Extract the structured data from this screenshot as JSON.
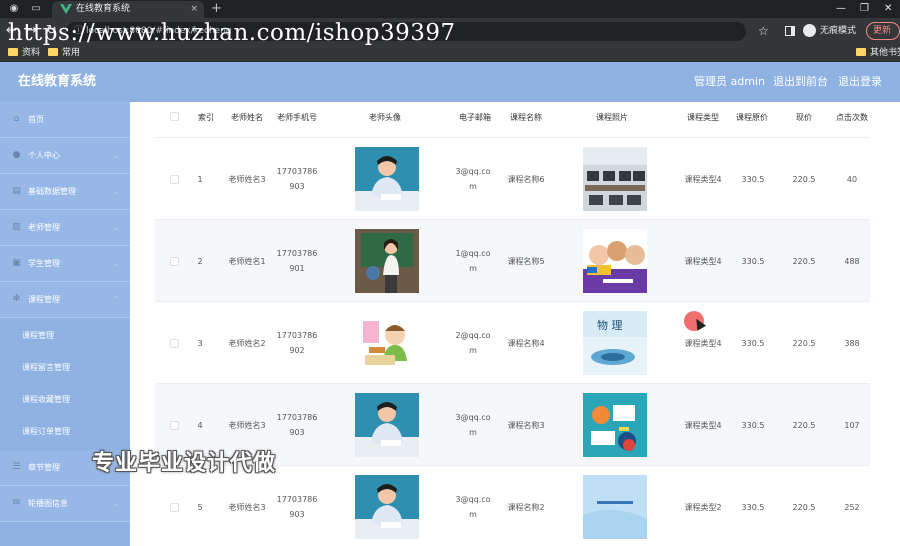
{
  "browser": {
    "tab_title": "在线教育系统",
    "tab_close": "×",
    "new_tab": "+",
    "url_text": "localhost:8080/#/index/kecheng",
    "url_watermark": "https://www.huzhan.com/ishop39397",
    "incognito_label": "无痕模式",
    "update_label": "更新",
    "bookmarks": [
      "资料",
      "常用"
    ],
    "other_bookmarks": "其他书签"
  },
  "header": {
    "title": "在线教育系统",
    "user": "管理员 admin",
    "back_to_front": "退出到前台",
    "logout": "退出登录"
  },
  "sidebar": {
    "items": [
      {
        "label": "首页",
        "icon": "home-icon"
      },
      {
        "label": "个人中心",
        "icon": "user-icon"
      },
      {
        "label": "基础数据管理",
        "icon": "database-icon"
      },
      {
        "label": "老师管理",
        "icon": "chart-icon"
      },
      {
        "label": "学生管理",
        "icon": "student-icon"
      },
      {
        "label": "课程管理",
        "icon": "gear-icon"
      }
    ],
    "sub_items": [
      {
        "label": "课程管理"
      },
      {
        "label": "课程留言管理"
      },
      {
        "label": "课程收藏管理"
      },
      {
        "label": "课程订单管理"
      }
    ],
    "items_after": [
      {
        "label": "章节管理",
        "icon": "list-icon"
      },
      {
        "label": "轮播图信息",
        "icon": "message-icon"
      }
    ]
  },
  "table": {
    "columns": [
      "索引",
      "老师姓名",
      "老师手机号",
      "老师头像",
      "电子邮箱",
      "课程名称",
      "课程照片",
      "课程类型",
      "课程原价",
      "现价",
      "点击次数"
    ],
    "rows": [
      {
        "index": "1",
        "teacher": "老师姓名3",
        "phone": "17703786903",
        "email": "3@qq.com",
        "course": "课程名称6",
        "type": "课程类型4",
        "original_price": "330.5",
        "price": "220.5",
        "clicks": "40",
        "avatar": "teacher-man",
        "photo": "computer-lab"
      },
      {
        "index": "2",
        "teacher": "老师姓名1",
        "phone": "17703786901",
        "email": "1@qq.com",
        "course": "课程名称5",
        "type": "课程类型4",
        "original_price": "330.5",
        "price": "220.5",
        "clicks": "488",
        "avatar": "teacher-woman",
        "photo": "ielts"
      },
      {
        "index": "3",
        "teacher": "老师姓名2",
        "phone": "17703786902",
        "email": "2@qq.com",
        "course": "课程名称4",
        "type": "课程类型4",
        "original_price": "330.5",
        "price": "220.5",
        "clicks": "388",
        "avatar": "cartoon-student",
        "photo": "physics"
      },
      {
        "index": "4",
        "teacher": "老师姓名3",
        "phone": "17703786903",
        "email": "3@qq.com",
        "course": "课程名称3",
        "type": "课程类型4",
        "original_price": "330.5",
        "price": "220.5",
        "clicks": "107",
        "avatar": "teacher-man",
        "photo": "teal-illustration"
      },
      {
        "index": "5",
        "teacher": "老师姓名3",
        "phone": "17703786903",
        "email": "3@qq.com",
        "course": "课程名称2",
        "type": "课程类型2",
        "original_price": "330.5",
        "price": "220.5",
        "clicks": "252",
        "avatar": "teacher-man",
        "photo": "blue-cover"
      }
    ]
  },
  "overlay_text": "专业毕业设计代做",
  "colors": {
    "sidebar": "#8fb2e3",
    "header": "#8fb2e3",
    "row_alt": "#f5f7fa"
  }
}
